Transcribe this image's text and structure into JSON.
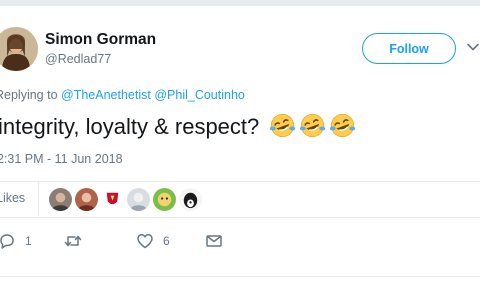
{
  "user": {
    "display_name": "Simon Gorman",
    "handle": "@Redlad77",
    "follow_label": "Follow"
  },
  "reply": {
    "prefix": "Replying to",
    "mentions": [
      "@TheAnethetist",
      "@Phil_Coutinho"
    ]
  },
  "tweet": {
    "text": "integrity, loyalty & respect?",
    "emoji": [
      "face-with-tears-of-joy",
      "face-with-tears-of-joy",
      "face-with-tears-of-joy"
    ]
  },
  "timestamp": "2:31 PM - 11 Jun 2018",
  "likes": {
    "count": "6",
    "label": "Likes",
    "avatar_icons": [
      "liker-avatar-person",
      "liker-avatar-person",
      "liker-avatar-club-crest",
      "liker-avatar-person",
      "liker-avatar-cartoon",
      "liker-avatar-dog"
    ]
  },
  "actions": {
    "reply_count": "1",
    "retweet_count": "",
    "like_count": "6"
  },
  "colors": {
    "accent": "#1da1f2",
    "secondary_text": "#657786",
    "border": "#e6ecf0"
  }
}
